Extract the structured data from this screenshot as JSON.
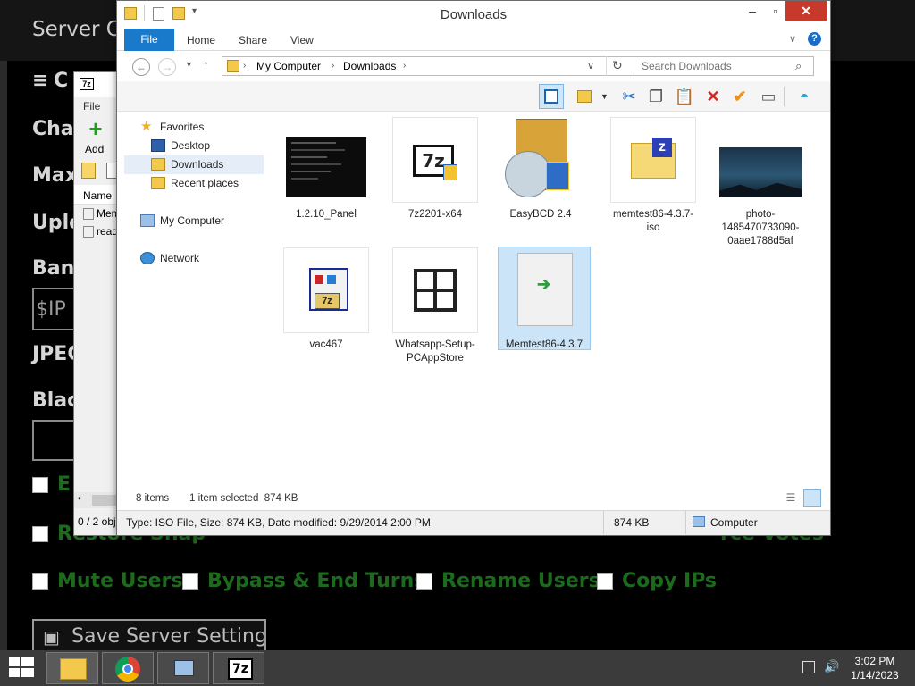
{
  "background_app": {
    "title": "Server Co",
    "labels": [
      "Cha",
      "Max",
      "Uplo",
      "Ban",
      "JPEG",
      "Blac"
    ],
    "top_label": "C",
    "ip_placeholder": "$IP",
    "checkbox_rows": [
      [
        {
          "label": "E"
        }
      ],
      [
        {
          "label": "Restore Shap"
        },
        {
          "label": "rce Votes"
        }
      ],
      [
        {
          "label": "Mute Users"
        },
        {
          "label": "Bypass & End Turns"
        },
        {
          "label": "Rename Users"
        },
        {
          "label": "Copy IPs"
        }
      ]
    ],
    "save_button": "Save Server Settings"
  },
  "zip_window": {
    "menu_file": "File",
    "add_label": "Add",
    "col_name": "Name",
    "rows": [
      "Mem",
      "read"
    ],
    "status": "0 / 2 obj"
  },
  "explorer": {
    "title": "Downloads",
    "tabs": {
      "file": "File",
      "home": "Home",
      "share": "Share",
      "view": "View"
    },
    "address": {
      "root": "My Computer",
      "current": "Downloads"
    },
    "search_placeholder": "Search Downloads",
    "nav": {
      "favorites": "Favorites",
      "desktop": "Desktop",
      "downloads": "Downloads",
      "recent": "Recent places",
      "computer": "My Computer",
      "network": "Network"
    },
    "files": [
      {
        "name": "1.2.10_Panel",
        "icon": "panel-thumbnail"
      },
      {
        "name": "7z2201-x64",
        "icon": "7zip-installer-icon"
      },
      {
        "name": "EasyBCD 2.4",
        "icon": "easybcd-icon"
      },
      {
        "name": "memtest86-4.3.7-iso",
        "icon": "zip-folder-icon"
      },
      {
        "name": "photo-1485470733090-0aae1788d5af",
        "icon": "photo-thumbnail"
      },
      {
        "name": "vac467",
        "icon": "7z-sfx-icon"
      },
      {
        "name": "Whatsapp-Setup-PCAppStore",
        "icon": "setup-grid-icon"
      },
      {
        "name": "Memtest86-4.3.7",
        "icon": "iso-file-icon",
        "selected": true
      }
    ],
    "status": {
      "count": "8 items",
      "selection": "1 item selected  874 KB"
    },
    "details": {
      "info": "Type: ISO File, Size: 874 KB, Date modified: 9/29/2014 2:00 PM",
      "size": "874 KB",
      "location": "Computer"
    }
  },
  "taskbar": {
    "time": "3:02 PM",
    "date": "1/14/2023"
  }
}
